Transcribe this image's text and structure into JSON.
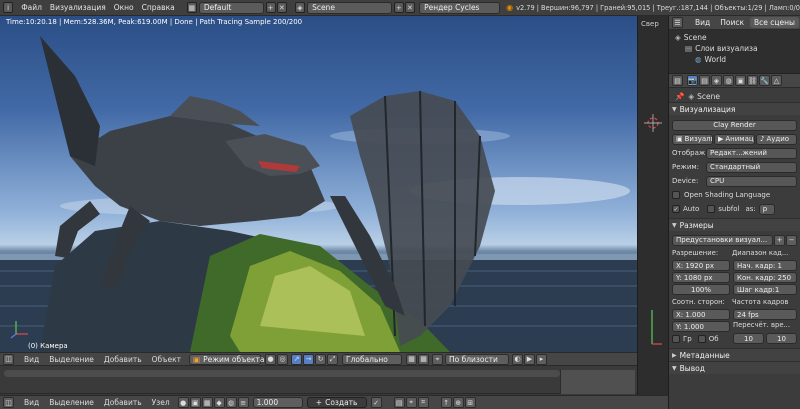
{
  "topbar": {
    "menu_file": "Файл",
    "menu_render": "Визуализация",
    "menu_window": "Окно",
    "menu_help": "Справка",
    "screen_layout": "Default",
    "scene_name": "Scene",
    "render_engine": "Рендер Cycles",
    "stats": "v2.79 | Вершин:96,797 | Граней:95,015 | Треуг.:187,144 | Объекты:1/29 | Ламп:0/0"
  },
  "viewport": {
    "render_info": "Time:10:20.18 | Mem:528.36M, Peak:619.00M | Done | Path Tracing Sample 200/200",
    "camera_label": "(0) Камера"
  },
  "viewport_header": {
    "view": "Вид",
    "select": "Выделение",
    "add": "Добавить",
    "object": "Объект",
    "mode": "Режим объекта",
    "pivot": "Глобально",
    "snap": "По близости"
  },
  "node_header": {
    "view": "Вид",
    "select": "Выделение",
    "add": "Добавить",
    "node": "Узел",
    "frame_value": "1.000",
    "create": "Создать"
  },
  "midstrip": {
    "label": "Свер"
  },
  "outliner": {
    "view": "Вид",
    "search": "Поиск",
    "all_scenes": "Все сцены",
    "items": [
      "Scene",
      "Слои визуализа",
      "World"
    ]
  },
  "properties": {
    "scene_path": "Scene",
    "render_section": "Визуализация",
    "clay_render": "Clay Render",
    "btn_render": "Визуали",
    "btn_anim": "Анимац",
    "btn_audio": "Аудио",
    "display_label": "Отображ:",
    "display_value": "Редакт...жений",
    "mode_label": "Режим:",
    "mode_value": "Стандартный",
    "device_label": "Device:",
    "device_value": "CPU",
    "osl_label": "Open Shading Language",
    "auto_label": "Auto",
    "subfol_label": "subfol",
    "as_label": "as:",
    "as_value": "p",
    "dimensions_section": "Размеры",
    "presets": "Предустановки визуал...",
    "resolution_label": "Разрешение:",
    "frame_range_label": "Диапазон кад...",
    "res_x": "X:  1920 px",
    "res_y": "Y:  1080 px",
    "res_pct": "100%",
    "frame_start": "Нач. кадр: 1",
    "frame_end": "Кон. кадр: 250",
    "frame_step": "Шаг кадр:1",
    "aspect_label": "Соотн. сторон:",
    "fps_label": "Частота кадров",
    "aspect_x": "X:  1.000",
    "aspect_y": "Y:  1.000",
    "fps_value": "24 fps",
    "remap_label": "Пересчёт. вре...",
    "border_label": "Гр",
    "crop_label": "Об",
    "remap_old": "10",
    "remap_new": "10",
    "metadata_section": "Метаданные",
    "output_section": "Вывод"
  }
}
